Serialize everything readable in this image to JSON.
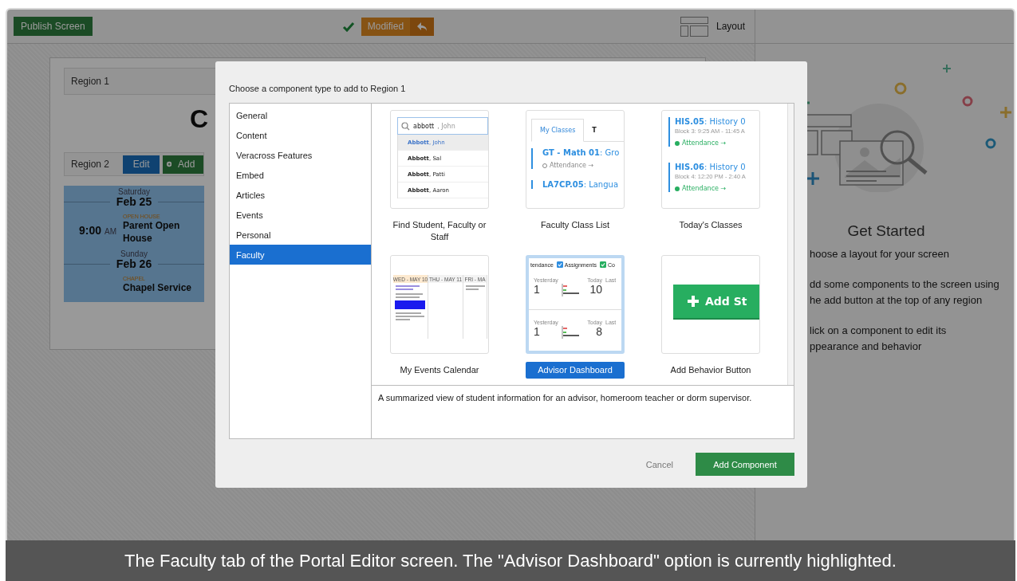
{
  "toolbar": {
    "publish_button": "Publish Screen",
    "status_button": "Modified",
    "layout_button": "Layout"
  },
  "editor": {
    "region_1": "Region 1",
    "heading": "C",
    "region_2": {
      "label": "Region 2",
      "edit_button": "Edit",
      "add_button": "Add"
    },
    "days": [
      {
        "weekday": "Saturday",
        "date": "Feb 25",
        "events": [
          {
            "time": "9:00",
            "meridiem": "AM",
            "category": "OPEN HOUSE",
            "title": "Parent Open House"
          }
        ]
      },
      {
        "weekday": "Sunday",
        "date": "Feb 26",
        "events": [
          {
            "category": "CHAPEL",
            "title": "Chapel Service"
          }
        ]
      }
    ]
  },
  "get_started": {
    "title": "Get Started",
    "steps": [
      {
        "lines": [
          "hoose a layout for your screen"
        ]
      },
      {
        "lines": [
          "dd some components to the screen using",
          "he add button at the top of any region"
        ]
      },
      {
        "lines": [
          "lick on a component to edit its",
          "ppearance and behavior"
        ]
      }
    ]
  },
  "dialog": {
    "prompt": "Choose a component type to add to Region 1",
    "categories": [
      {
        "label": "General",
        "selected": false
      },
      {
        "label": "Content",
        "selected": false
      },
      {
        "label": "Veracross Features",
        "selected": false
      },
      {
        "label": "Embed",
        "selected": false
      },
      {
        "label": "Articles",
        "selected": false
      },
      {
        "label": "Events",
        "selected": false
      },
      {
        "label": "Personal",
        "selected": false
      },
      {
        "label": "Faculty",
        "selected": true
      }
    ],
    "components": [
      {
        "kind": "search",
        "label": "Find Student, Faculty or Staff",
        "selected": false,
        "preview": {
          "query": "abbott",
          "hint": ", John",
          "results": [
            {
              "name": "**Abbott**, John",
              "selected": true
            },
            {
              "name": "**Abbott**, Sal",
              "selected": false
            },
            {
              "name": "**Abbott**, Patti",
              "selected": false
            },
            {
              "name": "**Abbott**, Aaron",
              "selected": false
            }
          ]
        }
      },
      {
        "kind": "class-list",
        "label": "Faculty Class List",
        "selected": false,
        "preview": {
          "tabs": [
            {
              "label": "My Classes",
              "selected": true
            },
            {
              "label": "T",
              "selected": false
            }
          ],
          "classes": [
            {
              "title": "**GT - Math 01**: Gro",
              "attendance": "Attendance →",
              "taken": false
            },
            {
              "title": "**LA7CP.05**: Langua"
            }
          ]
        }
      },
      {
        "kind": "todays-classes",
        "label": "Today's Classes",
        "selected": false,
        "preview": {
          "classes": [
            {
              "title": "**HIS.05**: History 0",
              "block": "Block 3: 9:25 AM - 11:45 A",
              "attendance": "Attendance →",
              "taken": true
            },
            {
              "title": "**HIS.06**: History 0",
              "block": "Block 4: 12:20 PM - 2:40 A",
              "attendance": "Attendance →",
              "taken": true
            }
          ]
        }
      },
      {
        "kind": "calendar",
        "label": "My Events Calendar",
        "selected": false,
        "preview": {
          "columns": [
            {
              "label": "WED - MAY 10",
              "selected": true
            },
            {
              "label": "THU - MAY 11",
              "selected": false
            },
            {
              "label": "FRI - MA",
              "selected": false
            }
          ]
        }
      },
      {
        "kind": "dashboard",
        "label": "Advisor Dashboard",
        "selected": true,
        "preview": {
          "filters": [
            {
              "label": "tendance"
            },
            {
              "label": "Assignments",
              "checked": true,
              "color": "#2f8ee0"
            },
            {
              "label": "Co",
              "checked": true,
              "color": "#27ae60"
            }
          ],
          "stats": [
            {
              "before_label": "Yesterday",
              "before": "1",
              "after_label": "Today",
              "after": "10",
              "extra": "Last"
            },
            {
              "before_label": "Yesterday",
              "before": "1",
              "after_label": "Today",
              "after": "8",
              "extra": "Last"
            }
          ]
        }
      },
      {
        "kind": "button",
        "label": "Add Behavior Button",
        "selected": false,
        "preview": {
          "button": "Add St"
        }
      }
    ],
    "description": "A summarized view of student information for an advisor, homeroom teacher or dorm supervisor.",
    "cancel_button": "Cancel",
    "confirm_button": "Add Component"
  },
  "caption": "The Faculty tab of the Portal Editor screen. The \"Advisor Dashboard\" option is currently highlighted."
}
